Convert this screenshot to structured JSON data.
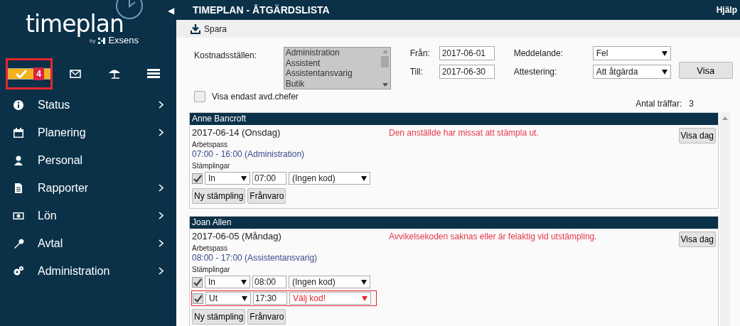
{
  "sidebar": {
    "logo": {
      "word": "timeplan",
      "by": "by",
      "brand": "Exsens"
    },
    "collapse_icon": "◀",
    "quick_icons": [
      {
        "kind": "check",
        "badge": "4",
        "selected": true,
        "highlighted": true
      },
      {
        "kind": "mail",
        "selected": false,
        "highlighted": false
      },
      {
        "kind": "umbrella",
        "selected": false,
        "highlighted": false
      },
      {
        "kind": "list",
        "selected": false,
        "highlighted": false
      }
    ],
    "menu": [
      {
        "label": "Status",
        "has_submenu": true
      },
      {
        "label": "Planering",
        "has_submenu": true
      },
      {
        "label": "Personal",
        "has_submenu": false
      },
      {
        "label": "Rapporter",
        "has_submenu": true
      },
      {
        "label": "Lön",
        "has_submenu": true
      },
      {
        "label": "Avtal",
        "has_submenu": true
      },
      {
        "label": "Administration",
        "has_submenu": true
      }
    ]
  },
  "header": {
    "title": "TIMEPLAN - ÅTGÄRDSLISTA",
    "help": "Hjälp"
  },
  "toolbar": {
    "save": "Spara"
  },
  "filters": {
    "cost_centers_label": "Kostnadsställen:",
    "cost_centers": [
      "Administration",
      "Assistent",
      "Assistentansvarig",
      "Butik"
    ],
    "from_label": "Från:",
    "from": "2017-06-01",
    "to_label": "Till:",
    "to": "2017-06-30",
    "message_label": "Meddelande:",
    "message": "Fel",
    "approval_label": "Attestering:",
    "approval": "Att åtgärda",
    "show_button": "Visa",
    "managers_only": {
      "label": "Visa endast avd.chefer",
      "checked": false
    },
    "hits_label": "Antal träffar:",
    "hits": "3"
  },
  "records": [
    {
      "name": "Anne Bancroft",
      "date": "2017-06-14 (Onsdag)",
      "message": "Den anställde har missat att stämpla ut.",
      "shift_label": "Arbetspass",
      "shift": "07:00 - 16:00 (Administration)",
      "stamps_label": "Stämplingar",
      "stamps": [
        {
          "checked": true,
          "direction": "In",
          "time": "07:00",
          "code": "(Ingen kod)",
          "error": false
        }
      ],
      "new_stamp": "Ny stämpling",
      "absence": "Frånvaro",
      "show_day": "Visa dag"
    },
    {
      "name": "Joan Allen",
      "date": "2017-06-05 (Måndag)",
      "message": "Avvikelsekoden saknas eller är felaktig vid utstämpling.",
      "shift_label": "Arbetspass",
      "shift": "08:00 - 17:00 (Assistentansvarig)",
      "stamps_label": "Stämplingar",
      "stamps": [
        {
          "checked": true,
          "direction": "In",
          "time": "08:00",
          "code": "(Ingen kod)",
          "error": false
        },
        {
          "checked": true,
          "direction": "Ut",
          "time": "17:30",
          "code": "Välj kod!",
          "error": true
        }
      ],
      "new_stamp": "Ny stämpling",
      "absence": "Frånvaro",
      "show_day": "Visa dag"
    }
  ]
}
